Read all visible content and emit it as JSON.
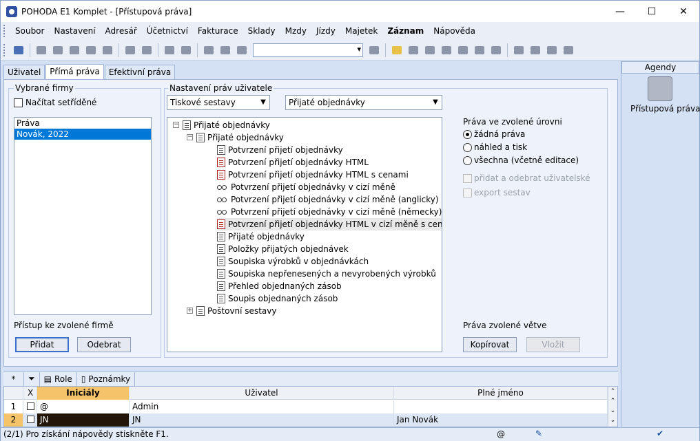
{
  "window": {
    "title": "POHODA E1 Komplet - [Přístupová práva]",
    "minimize": "—",
    "maximize": "☐",
    "close": "✕"
  },
  "menu": [
    "Soubor",
    "Nastavení",
    "Adresář",
    "Účetnictví",
    "Fakturace",
    "Sklady",
    "Mzdy",
    "Jízdy",
    "Majetek",
    "Záznam",
    "Nápověda"
  ],
  "tabs": [
    "Uživatel",
    "Přímá práva",
    "Efektivní práva"
  ],
  "left": {
    "group_title": "Vybrané firmy",
    "sort_checkbox_label": "Načítat setříděné",
    "list": [
      "Práva",
      "Novák, 2022"
    ],
    "access_label": "Přístup ke zvolené firmě",
    "add_button": "Přidat",
    "remove_button": "Odebrat"
  },
  "center": {
    "group_title": "Nastavení práv uživatele",
    "combo1": "Tiskové sestavy",
    "combo2": "Přijaté objednávky",
    "tree": [
      {
        "label": "Přijaté objednávky",
        "level": 0,
        "icon": "doc",
        "expander": "−"
      },
      {
        "label": "Přijaté objednávky",
        "level": 1,
        "icon": "doc",
        "expander": "−"
      },
      {
        "label": "Potvrzení přijetí objednávky",
        "level": 2,
        "icon": "doc"
      },
      {
        "label": "Potvrzení přijetí objednávky HTML",
        "level": 2,
        "icon": "red"
      },
      {
        "label": "Potvrzení přijetí objednávky HTML s cenami",
        "level": 2,
        "icon": "red"
      },
      {
        "label": "Potvrzení přijetí objednávky v cizí měně",
        "level": 2,
        "icon": "glasses"
      },
      {
        "label": "Potvrzení přijetí objednávky v cizí měně (anglicky)",
        "level": 2,
        "icon": "glasses"
      },
      {
        "label": "Potvrzení přijetí objednávky v cizí měně (německy)",
        "level": 2,
        "icon": "glasses"
      },
      {
        "label": "Potvrzení přijetí objednávky HTML v cizí měně s cenami",
        "level": 2,
        "icon": "red",
        "highlight": true
      },
      {
        "label": "Přijaté objednávky",
        "level": 2,
        "icon": "doc"
      },
      {
        "label": "Položky přijatých objednávek",
        "level": 2,
        "icon": "doc"
      },
      {
        "label": "Soupiska výrobků v objednávkách",
        "level": 2,
        "icon": "doc"
      },
      {
        "label": "Soupiska nepřenesených a nevyrobených výrobků",
        "level": 2,
        "icon": "doc"
      },
      {
        "label": "Přehled objednaných zásob",
        "level": 2,
        "icon": "doc"
      },
      {
        "label": "Soupis objednaných zásob",
        "level": 2,
        "icon": "doc"
      },
      {
        "label": "Poštovní sestavy",
        "level": 1,
        "icon": "doc",
        "expander": "+"
      }
    ]
  },
  "right": {
    "rights_title": "Práva ve zvolené úrovni",
    "radios": [
      "žádná práva",
      "náhled a tisk",
      "všechna (včetně editace)"
    ],
    "selected_radio": 0,
    "checkboxes": [
      "přidat a odebrat uživatelské",
      "export sestav"
    ],
    "branch_title": "Práva zvolené větve",
    "copy_button": "Kopírovat",
    "paste_button": "Vložit"
  },
  "agendy": {
    "title": "Agendy",
    "item": "Přístupová práva"
  },
  "bottom_tabs": [
    "*",
    "",
    "Role",
    "Poznámky"
  ],
  "grid": {
    "headers": [
      "",
      "X",
      "Iniciály",
      "Uživatel",
      "Plné jméno"
    ],
    "rows": [
      {
        "num": "1",
        "initials": "@",
        "user": "Admin",
        "fullname": ""
      },
      {
        "num": "2",
        "initials": "JN",
        "user": "JN",
        "fullname": "Jan Novák"
      }
    ]
  },
  "status": {
    "text": "(2/1) Pro získání nápovědy stiskněte F1.",
    "at": "@"
  },
  "colors": {
    "accent": "#0078d7",
    "header_orange": "#f5c46a",
    "panel": "#d4e1f5"
  }
}
